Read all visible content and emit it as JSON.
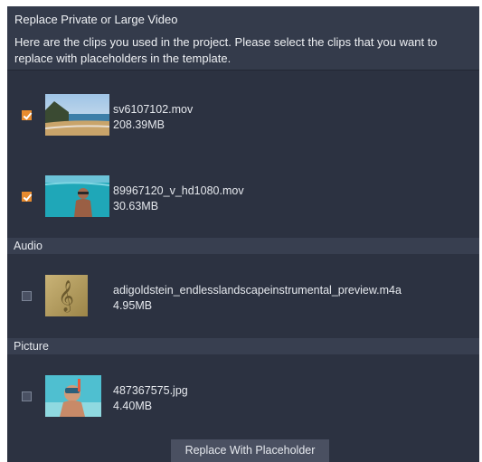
{
  "dialog": {
    "title": "Replace Private or Large Video",
    "description": "Here are the clips you used in the project. Please select the clips that you want to replace with placeholders in the template."
  },
  "videos": [
    {
      "name": "sv6107102.mov",
      "size": "208.39MB",
      "checked": true
    },
    {
      "name": "89967120_v_hd1080.mov",
      "size": "30.63MB",
      "checked": true
    }
  ],
  "sections": {
    "audio": "Audio",
    "picture": "Picture"
  },
  "audio": [
    {
      "name": "adigoldstein_endlesslandscapeinstrumental_preview.m4a",
      "size": "4.95MB",
      "checked": false
    }
  ],
  "pictures": [
    {
      "name": "487367575.jpg",
      "size": "4.40MB",
      "checked": false
    }
  ],
  "footer": {
    "button_label": "Replace With Placeholder"
  },
  "colors": {
    "accent": "#e88b2e",
    "background": "#2c3241"
  }
}
